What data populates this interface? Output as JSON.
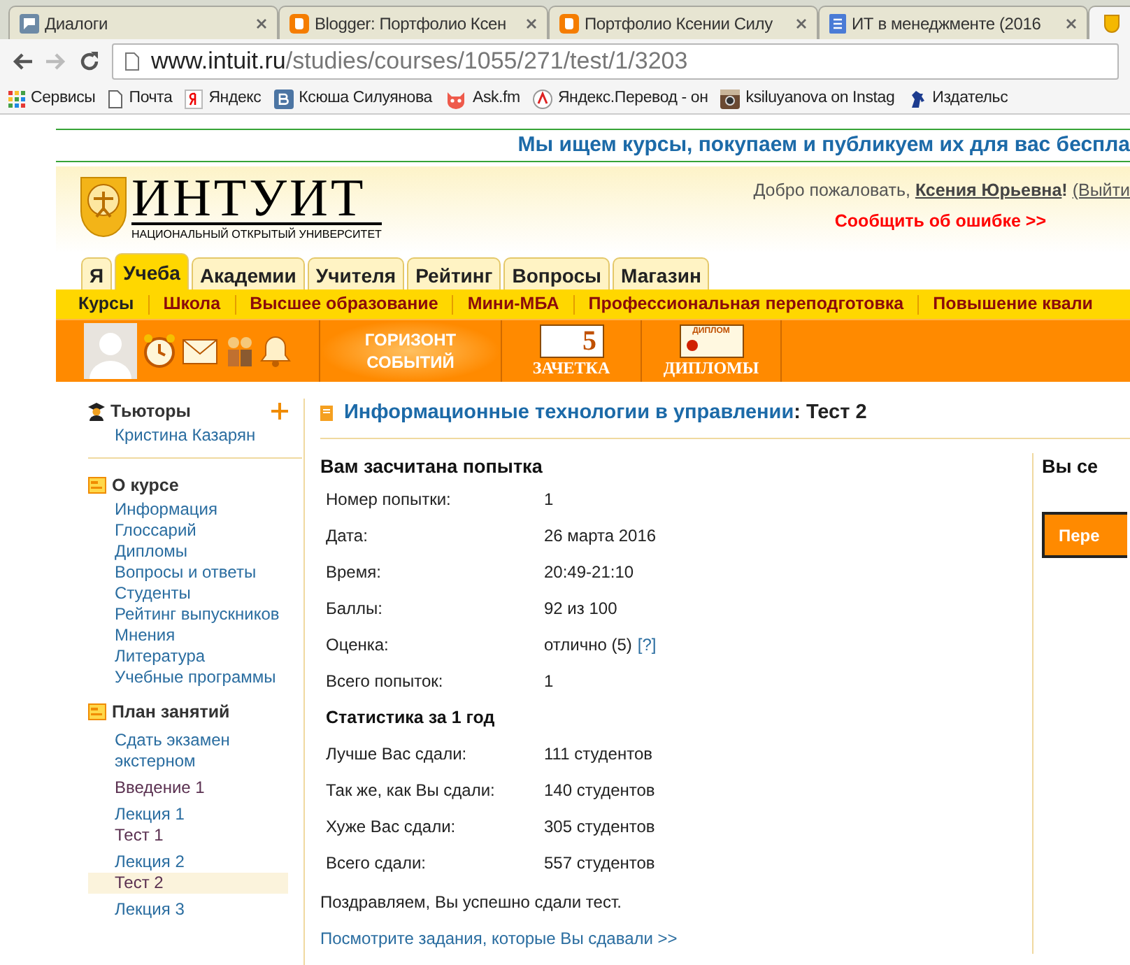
{
  "browser": {
    "tabs": [
      {
        "title": "Диалоги",
        "kind": "chat",
        "selected": false
      },
      {
        "title": "Blogger: Портфолио Ксен",
        "kind": "blogger",
        "selected": false
      },
      {
        "title": "Портфолио Ксении Силу",
        "kind": "blogger",
        "selected": false
      },
      {
        "title": "ИТ в менеджменте (2016",
        "kind": "doc",
        "selected": false
      }
    ],
    "url_host": "www.intuit.ru",
    "url_path": "/studies/courses/1055/271/test/1/3203",
    "bookmarks": [
      {
        "label": "Сервисы",
        "kind": "apps"
      },
      {
        "label": "Почта",
        "kind": "page"
      },
      {
        "label": "Яндекс",
        "kind": "yandex"
      },
      {
        "label": "Ксюша Силуянова",
        "kind": "vk"
      },
      {
        "label": "Ask.fm",
        "kind": "askfm"
      },
      {
        "label": "Яндекс.Перевод - он",
        "kind": "translate"
      },
      {
        "label": "ksiluyanova on Instag",
        "kind": "instagram"
      },
      {
        "label": "Издательс",
        "kind": "publisher"
      }
    ]
  },
  "banner": "Мы ищем курсы, покупаем и публикуем их для вас беспла",
  "header": {
    "logo": "ИНТУИТ",
    "logo_subtitle": "НАЦИОНАЛЬНЫЙ ОТКРЫТЫЙ УНИВЕРСИТЕТ",
    "welcome": "Добро пожаловать,",
    "user": "Ксения Юрьевна",
    "exclaim": "!",
    "logout": "(Выйти",
    "report": "Сообщить об ошибке >>"
  },
  "nav_tabs": [
    {
      "label": "Я",
      "selected": false
    },
    {
      "label": "Учеба",
      "selected": true
    },
    {
      "label": "Академии",
      "selected": false
    },
    {
      "label": "Учителя",
      "selected": false
    },
    {
      "label": "Рейтинг",
      "selected": false
    },
    {
      "label": "Вопросы",
      "selected": false
    },
    {
      "label": "Магазин",
      "selected": false
    }
  ],
  "sub_nav": [
    {
      "label": "Курсы",
      "selected": true
    },
    {
      "label": "Школа",
      "selected": false
    },
    {
      "label": "Высшее образование",
      "selected": false
    },
    {
      "label": "Мини-МБА",
      "selected": false
    },
    {
      "label": "Профессиональная переподготовка",
      "selected": false
    },
    {
      "label": "Повышение квали",
      "selected": false
    }
  ],
  "toolbar": {
    "horizon": [
      "ГОРИЗОНТ",
      "СОБЫТИЙ"
    ],
    "gradebook_mark": "5",
    "gradebook": "ЗАЧЕТКА",
    "diploma_stamp": "ДИПЛОМ",
    "diplomas": "ДИПЛОМЫ"
  },
  "sidebar": [
    {
      "title": "Тьюторы",
      "kind": "tutors",
      "items": [
        {
          "label": "Кристина Казарян",
          "visited": false,
          "selected": false
        }
      ]
    },
    {
      "title": "О курсе",
      "kind": "section",
      "items": [
        {
          "label": "Информация",
          "visited": false,
          "selected": false
        },
        {
          "label": "Глоссарий",
          "visited": false,
          "selected": false
        },
        {
          "label": "Дипломы",
          "visited": false,
          "selected": false
        },
        {
          "label": "Вопросы и ответы",
          "visited": false,
          "selected": false
        },
        {
          "label": "Студенты",
          "visited": false,
          "selected": false
        },
        {
          "label": "Рейтинг выпускников",
          "visited": false,
          "selected": false
        },
        {
          "label": "Мнения",
          "visited": false,
          "selected": false
        },
        {
          "label": "Литература",
          "visited": false,
          "selected": false
        },
        {
          "label": "Учебные программы",
          "visited": false,
          "selected": false
        }
      ]
    },
    {
      "title": "План занятий",
      "kind": "section",
      "items": [
        {
          "label": "Сдать экзамен экстерном",
          "visited": false,
          "selected": false
        },
        {
          "label": "Введение 1",
          "visited": true,
          "selected": false
        },
        {
          "label": "Лекция 1",
          "visited": false,
          "selected": false,
          "sub": "Тест 1",
          "sub_visited": true,
          "sub_selected": false
        },
        {
          "label": "Лекция 2",
          "visited": false,
          "selected": false,
          "sub": "Тест 2",
          "sub_visited": true,
          "sub_selected": true
        },
        {
          "label": "Лекция 3",
          "visited": false,
          "selected": false
        }
      ]
    }
  ],
  "page_title": {
    "course": "Информационные технологии в управлении",
    "sep": ":",
    "test": "Тест 2"
  },
  "result": {
    "heading": "Вам засчитана попытка",
    "rows": [
      {
        "label": "Номер попытки:",
        "value": "1"
      },
      {
        "label": "Дата:",
        "value": "26 марта 2016"
      },
      {
        "label": "Время:",
        "value": "20:49-21:10"
      },
      {
        "label": "Баллы:",
        "value": "92 из 100"
      },
      {
        "label": "Оценка:",
        "value": "отлично (5)",
        "help": "[?]"
      },
      {
        "label": "Всего попыток:",
        "value": "1"
      }
    ],
    "stats_heading": "Статистика за 1 год",
    "stats": [
      {
        "label": "Лучше Вас сдали:",
        "value": "111 студентов"
      },
      {
        "label": "Так же, как Вы сдали:",
        "value": "140 студентов"
      },
      {
        "label": "Хуже Вас сдали:",
        "value": "305 студентов"
      },
      {
        "label": "Всего сдали:",
        "value": "557 студентов"
      }
    ],
    "congrats": "Поздравляем, Вы успешно сдали тест.",
    "review_link": "Посмотрите задания, которые Вы сдавали >>"
  },
  "right": {
    "heading": "Вы се",
    "button": "Пере"
  }
}
